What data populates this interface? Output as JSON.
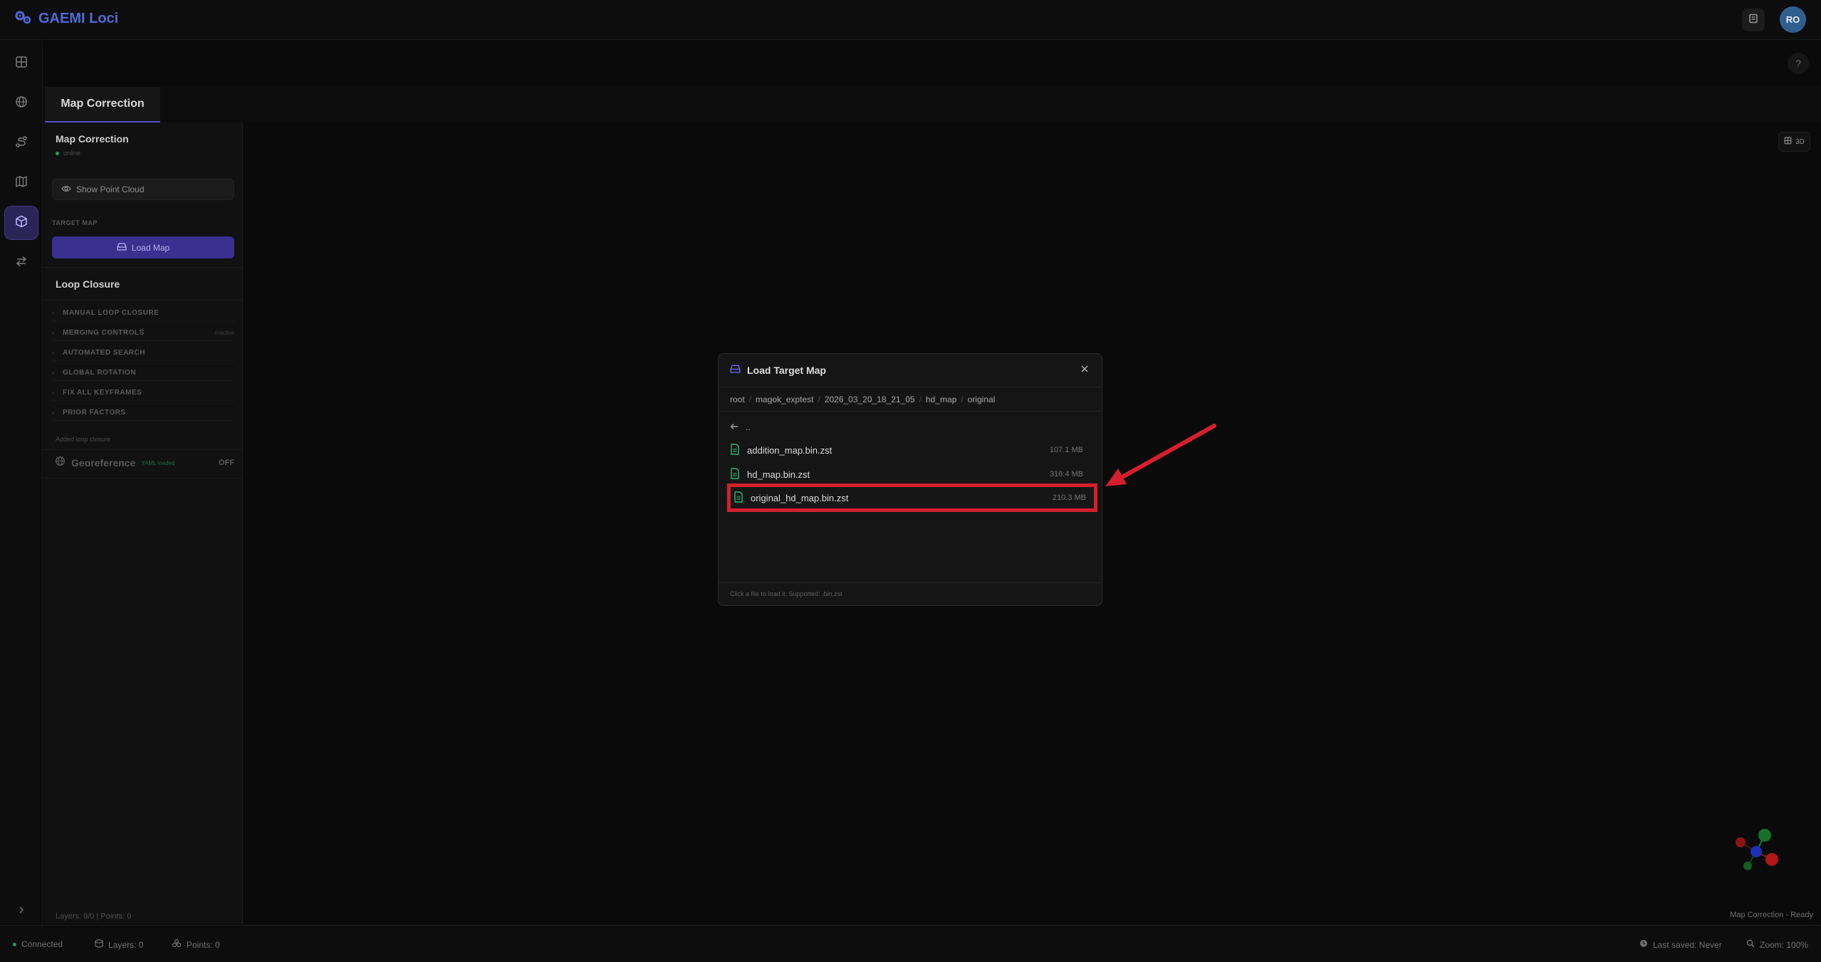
{
  "app": {
    "name": "GAEMI Loci",
    "avatar": "RO",
    "accent": "#5a4fcf"
  },
  "nav": [
    {
      "icon": "grid-icon"
    },
    {
      "icon": "globe-icon"
    },
    {
      "icon": "route-icon"
    },
    {
      "icon": "map-icon"
    },
    {
      "icon": "cube-icon",
      "active": true
    },
    {
      "icon": "swap-icon"
    }
  ],
  "help_label": "?",
  "tabs": [
    {
      "label": "Map Correction"
    }
  ],
  "panel": {
    "title": "Map Correction",
    "status": "online",
    "show_point_cloud": "Show Point Cloud",
    "target_map_label": "TARGET MAP",
    "load_map": "Load Map",
    "loop_closure_title": "Loop Closure",
    "accordion": [
      {
        "label": "MANUAL LOOP CLOSURE",
        "badge": ""
      },
      {
        "label": "MERGING CONTROLS",
        "badge": "inactive"
      },
      {
        "label": "AUTOMATED SEARCH",
        "badge": ""
      },
      {
        "label": "GLOBAL ROTATION",
        "badge": ""
      },
      {
        "label": "FIX ALL KEYFRAMES",
        "badge": ""
      },
      {
        "label": "PRIOR FACTORS",
        "badge": ""
      }
    ],
    "hint": "Added loop closure",
    "georeference": {
      "title": "Georeference",
      "badge": "YAML loaded",
      "state": "OFF"
    },
    "footer": "Layers: 0/0 | Points: 0"
  },
  "viewport": {
    "view_toggle": "3D",
    "status": "Map Correction - Ready"
  },
  "status_bar": {
    "connection": "Connected",
    "layers": "Layers: 0",
    "points": "Points: 0",
    "last_saved": "Last saved: Never",
    "zoom": "Zoom: 100%"
  },
  "modal": {
    "title": "Load Target Map",
    "breadcrumb": [
      "root",
      "magok_exptest",
      "2026_03_20_18_21_05",
      "hd_map",
      "original"
    ],
    "parent": "..",
    "files": [
      {
        "name": "addition_map.bin.zst",
        "size": "107.1 MB"
      },
      {
        "name": "hd_map.bin.zst",
        "size": "316.4 MB"
      },
      {
        "name": "original_hd_map.bin.zst",
        "size": "210.3 MB",
        "highlighted": true
      }
    ],
    "footer": "Click a file to load it. Supported: .bin.zst",
    "highlight_color": "#d61f2c"
  }
}
